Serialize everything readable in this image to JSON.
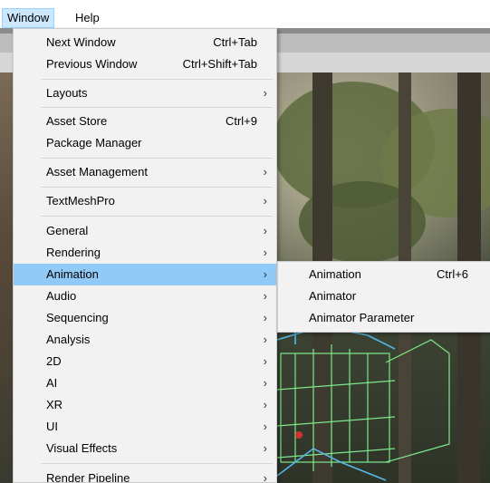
{
  "menubar": {
    "items": [
      {
        "label": "Window",
        "active": true
      },
      {
        "label": "Help",
        "active": false
      }
    ]
  },
  "window_menu": {
    "items": [
      {
        "label": "Next Window",
        "shortcut": "Ctrl+Tab"
      },
      {
        "label": "Previous Window",
        "shortcut": "Ctrl+Shift+Tab"
      },
      {
        "label": "Layouts",
        "submenu": true
      },
      {
        "label": "Asset Store",
        "shortcut": "Ctrl+9"
      },
      {
        "label": "Package Manager"
      },
      {
        "label": "Asset Management",
        "submenu": true
      },
      {
        "label": "TextMeshPro",
        "submenu": true
      },
      {
        "label": "General",
        "submenu": true
      },
      {
        "label": "Rendering",
        "submenu": true
      },
      {
        "label": "Animation",
        "submenu": true,
        "highlighted": true
      },
      {
        "label": "Audio",
        "submenu": true
      },
      {
        "label": "Sequencing",
        "submenu": true
      },
      {
        "label": "Analysis",
        "submenu": true
      },
      {
        "label": "2D",
        "submenu": true
      },
      {
        "label": "AI",
        "submenu": true
      },
      {
        "label": "XR",
        "submenu": true
      },
      {
        "label": "UI",
        "submenu": true
      },
      {
        "label": "Visual Effects",
        "submenu": true
      },
      {
        "label": "Render Pipeline",
        "submenu": true
      }
    ]
  },
  "animation_submenu": {
    "items": [
      {
        "label": "Animation",
        "shortcut": "Ctrl+6"
      },
      {
        "label": "Animator"
      },
      {
        "label": "Animator Parameter"
      }
    ]
  },
  "icons": {
    "submenu_arrow": "chevron-right-icon",
    "arrow_glyph": "›"
  },
  "colors": {
    "menu_bg": "#f2f2f2",
    "highlight": "#91c9f7",
    "menubar_active": "#cce8ff",
    "separator": "#d7d7d7"
  }
}
